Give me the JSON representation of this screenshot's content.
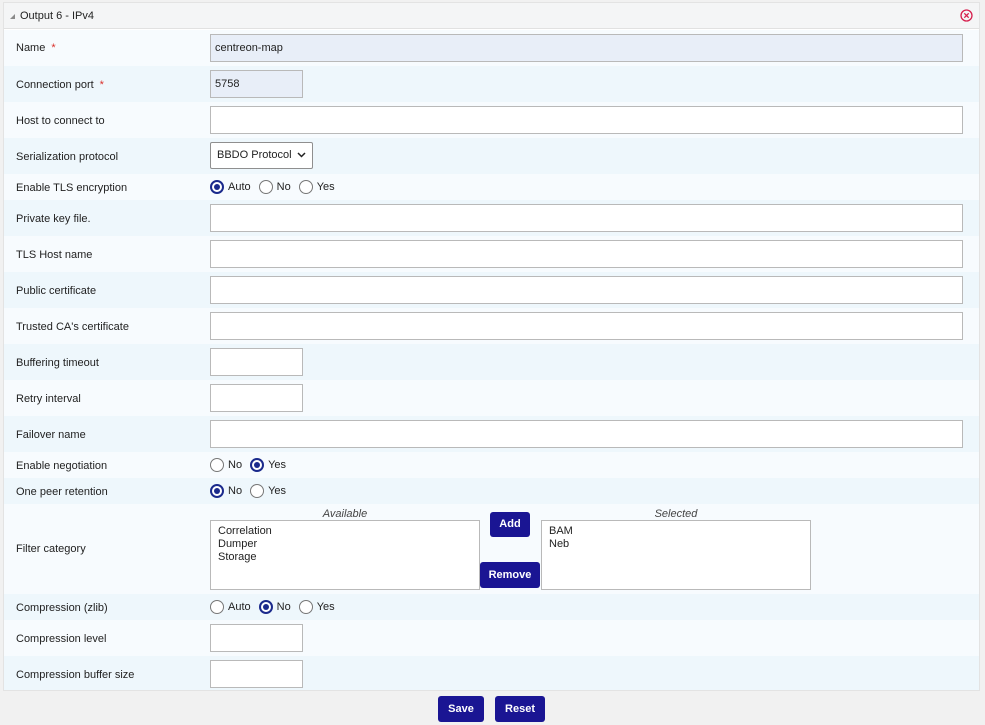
{
  "panel": {
    "title": "Output 6 - IPv4"
  },
  "fields": {
    "name": {
      "label": "Name",
      "required": "*",
      "value": "centreon-map"
    },
    "connection_port": {
      "label": "Connection port",
      "required": "*",
      "value": "5758"
    },
    "host": {
      "label": "Host to connect to",
      "value": ""
    },
    "serialization": {
      "label": "Serialization protocol",
      "selected": "BBDO Protocol"
    },
    "tls": {
      "label": "Enable TLS encryption",
      "options": [
        "Auto",
        "No",
        "Yes"
      ],
      "selected": "Auto"
    },
    "private_key": {
      "label": "Private key file.",
      "value": ""
    },
    "tls_host": {
      "label": "TLS Host name",
      "value": ""
    },
    "public_cert": {
      "label": "Public certificate",
      "value": ""
    },
    "trusted_ca": {
      "label": "Trusted CA's certificate",
      "value": ""
    },
    "buffering_timeout": {
      "label": "Buffering timeout",
      "value": ""
    },
    "retry_interval": {
      "label": "Retry interval",
      "value": ""
    },
    "failover": {
      "label": "Failover name",
      "value": ""
    },
    "negotiation": {
      "label": "Enable negotiation",
      "options": [
        "No",
        "Yes"
      ],
      "selected": "Yes"
    },
    "one_peer": {
      "label": "One peer retention",
      "options": [
        "No",
        "Yes"
      ],
      "selected": "No"
    },
    "filter": {
      "label": "Filter category",
      "available_caption": "Available",
      "selected_caption": "Selected",
      "available": [
        "Correlation",
        "Dumper",
        "Storage"
      ],
      "selected": [
        "BAM",
        "Neb"
      ],
      "add_label": "Add",
      "remove_label": "Remove"
    },
    "compression": {
      "label": "Compression (zlib)",
      "options": [
        "Auto",
        "No",
        "Yes"
      ],
      "selected": "No"
    },
    "compression_level": {
      "label": "Compression level",
      "value": ""
    },
    "compression_buffer": {
      "label": "Compression buffer size",
      "value": ""
    }
  },
  "footer": {
    "save_label": "Save",
    "reset_label": "Reset"
  },
  "colors": {
    "primary": "#1a1593",
    "required": "#d9302a",
    "close_icon": "#d6204e"
  }
}
